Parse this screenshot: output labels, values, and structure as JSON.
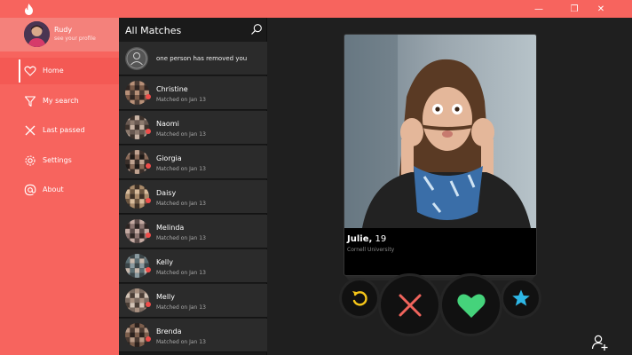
{
  "window": {
    "minimize_glyph": "—",
    "restore_glyph": "❐",
    "close_glyph": "✕"
  },
  "profile": {
    "name": "Rudy",
    "subtitle": "see your profile"
  },
  "nav": [
    {
      "label": "Home",
      "icon": "heart-outline-icon",
      "active": true
    },
    {
      "label": "My search",
      "icon": "filter-icon",
      "active": false
    },
    {
      "label": "Last passed",
      "icon": "cross-icon",
      "active": false
    },
    {
      "label": "Settings",
      "icon": "gear-icon",
      "active": false
    },
    {
      "label": "About",
      "icon": "at-icon",
      "active": false
    }
  ],
  "matches": {
    "title": "All Matches",
    "removed_notice": "one person has removed you",
    "items": [
      {
        "name": "Christine",
        "sub": "Matched on Jan 13"
      },
      {
        "name": "Naomi",
        "sub": "Matched on Jan 13"
      },
      {
        "name": "Giorgia",
        "sub": "Matched on Jan 13"
      },
      {
        "name": "Daisy",
        "sub": "Matched on Jan 13"
      },
      {
        "name": "Melinda",
        "sub": "Matched on Jan 13"
      },
      {
        "name": "Kelly",
        "sub": "Matched on Jan 13"
      },
      {
        "name": "Melly",
        "sub": "Matched on Jan 13"
      },
      {
        "name": "Brenda",
        "sub": "Matched on Jan 13"
      }
    ]
  },
  "card": {
    "name": "Julie,",
    "age": " 19",
    "school": "Cornell University"
  },
  "colors": {
    "accent": "#f7645e",
    "rewind": "#f6c619",
    "nope": "#f0645c",
    "like": "#45d37b",
    "superlike": "#2db7e6"
  }
}
